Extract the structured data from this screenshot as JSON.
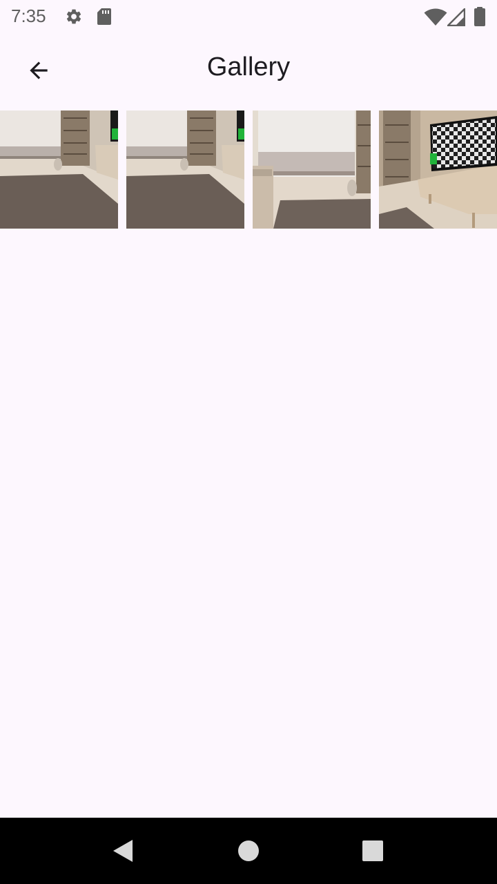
{
  "status_bar": {
    "time": "7:35",
    "left_icons": [
      "gear-icon",
      "sd-card-icon"
    ],
    "right_icons": [
      "wifi-icon",
      "signal-icon",
      "battery-icon"
    ]
  },
  "app_bar": {
    "back_icon": "arrow-left-icon",
    "title": "Gallery"
  },
  "gallery": {
    "items": [
      {
        "scene": "room-view-left-tv-edge"
      },
      {
        "scene": "room-view-left-tv-edge"
      },
      {
        "scene": "room-view-window-couch"
      },
      {
        "scene": "room-view-tv-checkerboard"
      }
    ]
  },
  "nav_bar": {
    "buttons": [
      "back-triangle-icon",
      "home-circle-icon",
      "recents-square-icon"
    ]
  },
  "colors": {
    "background": "#fdf7fe",
    "text_primary": "#1d1b20",
    "status_text": "#5f5f5f",
    "nav_background": "#000000"
  }
}
